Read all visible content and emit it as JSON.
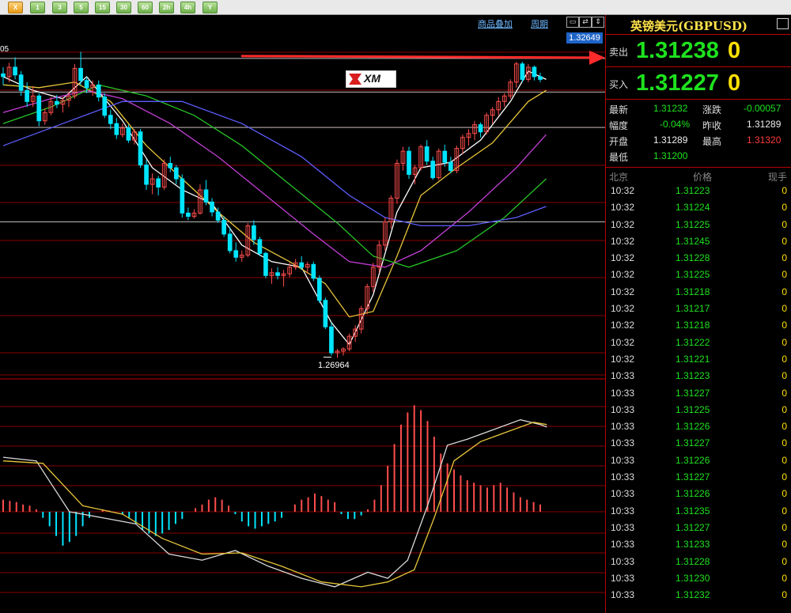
{
  "toolbar": {
    "buttons": [
      "X",
      "1",
      "3",
      "5",
      "15",
      "30",
      "60",
      "2h",
      "4h",
      "Y"
    ]
  },
  "chart_header": {
    "overlay_link": "商品叠加",
    "period_link": "周期",
    "price_tag": "1.32649",
    "low_label": "1.26964",
    "top_left_label": "05"
  },
  "colors": {
    "up": "#ff4d4d",
    "down": "#00e5ff",
    "ma1": "#ffffff",
    "ma2": "#e7c53a",
    "ma3": "#c33fd6",
    "ma4": "#27c327",
    "ma5": "#5d5dff",
    "macd_dif": "#d8d8d8",
    "macd_dea": "#e7c53a",
    "grid": "#8a0000",
    "arrow": "#ff2a2a"
  },
  "chart_data": {
    "type": "candlestick",
    "ylim": [
      1.2665,
      1.3285
    ],
    "reference_lines": [
      1.3238,
      1.3177,
      1.3113,
      1.2942
    ],
    "candles": [
      [
        1.321,
        1.3222,
        1.319,
        1.3205
      ],
      [
        1.3205,
        1.323,
        1.3195,
        1.3222
      ],
      [
        1.3222,
        1.324,
        1.32,
        1.3208
      ],
      [
        1.3208,
        1.3215,
        1.317,
        1.318
      ],
      [
        1.318,
        1.3195,
        1.315,
        1.316
      ],
      [
        1.316,
        1.3188,
        1.315,
        1.317
      ],
      [
        1.317,
        1.3175,
        1.3115,
        1.3125
      ],
      [
        1.3125,
        1.3148,
        1.3118,
        1.314
      ],
      [
        1.314,
        1.3168,
        1.3135,
        1.316
      ],
      [
        1.316,
        1.3172,
        1.3148,
        1.3155
      ],
      [
        1.3155,
        1.3168,
        1.314,
        1.3162
      ],
      [
        1.3162,
        1.3178,
        1.315,
        1.317
      ],
      [
        1.317,
        1.3228,
        1.3165,
        1.322
      ],
      [
        1.322,
        1.325,
        1.319,
        1.3198
      ],
      [
        1.3198,
        1.3205,
        1.3175,
        1.3185
      ],
      [
        1.3185,
        1.3198,
        1.317,
        1.319
      ],
      [
        1.319,
        1.3198,
        1.316,
        1.3168
      ],
      [
        1.3168,
        1.3175,
        1.313,
        1.3135
      ],
      [
        1.3135,
        1.3145,
        1.311,
        1.312
      ],
      [
        1.312,
        1.313,
        1.3092,
        1.31
      ],
      [
        1.31,
        1.312,
        1.3095,
        1.3112
      ],
      [
        1.3112,
        1.3118,
        1.3085,
        1.309
      ],
      [
        1.309,
        1.311,
        1.3082,
        1.3105
      ],
      [
        1.3105,
        1.311,
        1.304,
        1.3045
      ],
      [
        1.3045,
        1.3055,
        1.3,
        1.301
      ],
      [
        1.301,
        1.303,
        1.2992,
        1.302
      ],
      [
        1.302,
        1.3025,
        1.299,
        1.3005
      ],
      [
        1.3005,
        1.3055,
        1.3,
        1.3048
      ],
      [
        1.3048,
        1.306,
        1.3032,
        1.304
      ],
      [
        1.304,
        1.3045,
        1.301,
        1.302
      ],
      [
        1.302,
        1.3028,
        1.295,
        1.2958
      ],
      [
        1.2958,
        1.2968,
        1.2945,
        1.2952
      ],
      [
        1.2952,
        1.2965,
        1.2948,
        1.2958
      ],
      [
        1.2958,
        1.301,
        1.2955,
        1.3
      ],
      [
        1.3,
        1.3018,
        1.2972,
        1.2978
      ],
      [
        1.2978,
        1.2985,
        1.2952,
        1.296
      ],
      [
        1.296,
        1.2968,
        1.294,
        1.2945
      ],
      [
        1.2945,
        1.2952,
        1.2915,
        1.292
      ],
      [
        1.292,
        1.2932,
        1.2885,
        1.289
      ],
      [
        1.289,
        1.2905,
        1.287,
        1.2878
      ],
      [
        1.2878,
        1.289,
        1.287,
        1.2882
      ],
      [
        1.2882,
        1.294,
        1.2878,
        1.2935
      ],
      [
        1.2935,
        1.2945,
        1.29,
        1.291
      ],
      [
        1.291,
        1.2915,
        1.288,
        1.2885
      ],
      [
        1.2885,
        1.2888,
        1.284,
        1.2845
      ],
      [
        1.2845,
        1.2858,
        1.283,
        1.285
      ],
      [
        1.285,
        1.286,
        1.2838,
        1.2845
      ],
      [
        1.2845,
        1.2855,
        1.2825,
        1.2848
      ],
      [
        1.2848,
        1.2868,
        1.2842,
        1.286
      ],
      [
        1.286,
        1.2875,
        1.2855,
        1.2868
      ],
      [
        1.2868,
        1.288,
        1.2855,
        1.286
      ],
      [
        1.286,
        1.287,
        1.2848,
        1.2865
      ],
      [
        1.2865,
        1.287,
        1.2835,
        1.284
      ],
      [
        1.284,
        1.2845,
        1.2795,
        1.28
      ],
      [
        1.28,
        1.2805,
        1.2748,
        1.2752
      ],
      [
        1.2752,
        1.276,
        1.27,
        1.2705
      ],
      [
        1.2705,
        1.2712,
        1.2696,
        1.2708
      ],
      [
        1.2708,
        1.2715,
        1.27,
        1.2712
      ],
      [
        1.2712,
        1.274,
        1.2708,
        1.2735
      ],
      [
        1.2735,
        1.2755,
        1.2725,
        1.2748
      ],
      [
        1.2748,
        1.279,
        1.274,
        1.2785
      ],
      [
        1.2785,
        1.283,
        1.2775,
        1.2825
      ],
      [
        1.2825,
        1.2868,
        1.2815,
        1.286
      ],
      [
        1.286,
        1.2908,
        1.285,
        1.29
      ],
      [
        1.29,
        1.295,
        1.289,
        1.2942
      ],
      [
        1.2942,
        1.299,
        1.293,
        1.2985
      ],
      [
        1.2985,
        1.3055,
        1.2975,
        1.3048
      ],
      [
        1.3048,
        1.3078,
        1.3035,
        1.307
      ],
      [
        1.307,
        1.3078,
        1.302,
        1.3028
      ],
      [
        1.3028,
        1.3045,
        1.301,
        1.304
      ],
      [
        1.304,
        1.3082,
        1.3035,
        1.3078
      ],
      [
        1.3078,
        1.309,
        1.3045,
        1.3052
      ],
      [
        1.3052,
        1.306,
        1.3018,
        1.3022
      ],
      [
        1.3022,
        1.3075,
        1.3018,
        1.307
      ],
      [
        1.307,
        1.3082,
        1.3042,
        1.305
      ],
      [
        1.305,
        1.306,
        1.303,
        1.3035
      ],
      [
        1.3035,
        1.308,
        1.303,
        1.3075
      ],
      [
        1.3075,
        1.31,
        1.3065,
        1.3095
      ],
      [
        1.3095,
        1.311,
        1.308,
        1.3102
      ],
      [
        1.3102,
        1.3125,
        1.309,
        1.3118
      ],
      [
        1.3118,
        1.3122,
        1.3095,
        1.3105
      ],
      [
        1.3105,
        1.314,
        1.31,
        1.3135
      ],
      [
        1.3135,
        1.315,
        1.312,
        1.3145
      ],
      [
        1.3145,
        1.3168,
        1.3135,
        1.316
      ],
      [
        1.316,
        1.3175,
        1.315,
        1.317
      ],
      [
        1.317,
        1.32,
        1.3165,
        1.3195
      ],
      [
        1.3195,
        1.3232,
        1.3185,
        1.3228
      ],
      [
        1.3228,
        1.3232,
        1.3195,
        1.32
      ],
      [
        1.32,
        1.3228,
        1.3195,
        1.3222
      ],
      [
        1.3222,
        1.3225,
        1.3198,
        1.3205
      ],
      [
        1.3205,
        1.3212,
        1.3195,
        1.32
      ]
    ],
    "low_marker_index": 55,
    "moving_averages": [
      {
        "key": "ma1",
        "points": [
          [
            0,
            1.3205
          ],
          [
            5,
            1.318
          ],
          [
            10,
            1.3165
          ],
          [
            14,
            1.3205
          ],
          [
            20,
            1.3125
          ],
          [
            25,
            1.304
          ],
          [
            30,
            1.3
          ],
          [
            35,
            1.2975
          ],
          [
            40,
            1.29
          ],
          [
            45,
            1.287
          ],
          [
            50,
            1.286
          ],
          [
            55,
            1.276
          ],
          [
            58,
            1.272
          ],
          [
            62,
            1.281
          ],
          [
            66,
            1.296
          ],
          [
            70,
            1.304
          ],
          [
            75,
            1.305
          ],
          [
            80,
            1.309
          ],
          [
            85,
            1.316
          ],
          [
            88,
            1.3215
          ],
          [
            91,
            1.32
          ]
        ]
      },
      {
        "key": "ma2",
        "points": [
          [
            0,
            1.319
          ],
          [
            6,
            1.3185
          ],
          [
            12,
            1.3195
          ],
          [
            18,
            1.316
          ],
          [
            24,
            1.308
          ],
          [
            30,
            1.302
          ],
          [
            36,
            1.296
          ],
          [
            42,
            1.2905
          ],
          [
            48,
            1.287
          ],
          [
            54,
            1.283
          ],
          [
            58,
            1.277
          ],
          [
            62,
            1.278
          ],
          [
            66,
            1.288
          ],
          [
            70,
            1.299
          ],
          [
            76,
            1.304
          ],
          [
            82,
            1.3085
          ],
          [
            88,
            1.316
          ],
          [
            91,
            1.318
          ]
        ]
      },
      {
        "key": "ma3",
        "points": [
          [
            0,
            1.314
          ],
          [
            8,
            1.3165
          ],
          [
            14,
            1.318
          ],
          [
            20,
            1.3165
          ],
          [
            28,
            1.312
          ],
          [
            36,
            1.306
          ],
          [
            44,
            1.299
          ],
          [
            52,
            1.292
          ],
          [
            58,
            1.287
          ],
          [
            64,
            1.286
          ],
          [
            70,
            1.289
          ],
          [
            78,
            1.296
          ],
          [
            86,
            1.304
          ],
          [
            91,
            1.31
          ]
        ]
      },
      {
        "key": "ma4",
        "points": [
          [
            0,
            1.312
          ],
          [
            8,
            1.315
          ],
          [
            16,
            1.319
          ],
          [
            24,
            1.317
          ],
          [
            32,
            1.3135
          ],
          [
            40,
            1.308
          ],
          [
            48,
            1.301
          ],
          [
            56,
            1.294
          ],
          [
            62,
            1.288
          ],
          [
            68,
            1.286
          ],
          [
            76,
            1.289
          ],
          [
            84,
            1.295
          ],
          [
            91,
            1.302
          ]
        ]
      },
      {
        "key": "ma5",
        "points": [
          [
            0,
            1.308
          ],
          [
            10,
            1.312
          ],
          [
            20,
            1.316
          ],
          [
            30,
            1.316
          ],
          [
            40,
            1.312
          ],
          [
            50,
            1.306
          ],
          [
            58,
            1.299
          ],
          [
            64,
            1.295
          ],
          [
            70,
            1.2935
          ],
          [
            78,
            1.2935
          ],
          [
            86,
            1.295
          ],
          [
            91,
            1.297
          ]
        ]
      }
    ],
    "macd": {
      "ylim": [
        -1.0,
        1.0
      ],
      "histogram": [
        0.1,
        0.09,
        0.08,
        0.06,
        0.05,
        0.02,
        -0.05,
        -0.12,
        -0.2,
        -0.28,
        -0.25,
        -0.2,
        -0.12,
        -0.05,
        0.0,
        0.02,
        0.01,
        0.0,
        -0.02,
        -0.05,
        -0.1,
        -0.15,
        -0.18,
        -0.2,
        -0.18,
        -0.15,
        -0.1,
        -0.06,
        0.0,
        0.03,
        0.06,
        0.1,
        0.12,
        0.1,
        0.05,
        -0.02,
        -0.08,
        -0.12,
        -0.14,
        -0.12,
        -0.1,
        -0.08,
        -0.05,
        0.0,
        0.06,
        0.1,
        0.12,
        0.15,
        0.13,
        0.1,
        0.08,
        -0.02,
        -0.06,
        -0.06,
        -0.03,
        0.02,
        0.1,
        0.22,
        0.38,
        0.56,
        0.72,
        0.82,
        0.88,
        0.84,
        0.75,
        0.62,
        0.48,
        0.4,
        0.35,
        0.3,
        0.26,
        0.24,
        0.22,
        0.2,
        0.22,
        0.24,
        0.2,
        0.16,
        0.12,
        0.1,
        0.08,
        0.06
      ],
      "dif": [
        [
          0,
          0.45
        ],
        [
          5,
          0.42
        ],
        [
          10,
          0.0
        ],
        [
          15,
          -0.05
        ],
        [
          20,
          -0.1
        ],
        [
          25,
          -0.35
        ],
        [
          30,
          -0.4
        ],
        [
          35,
          -0.32
        ],
        [
          40,
          -0.45
        ],
        [
          45,
          -0.55
        ],
        [
          50,
          -0.62
        ],
        [
          55,
          -0.5
        ],
        [
          58,
          -0.55
        ],
        [
          61,
          -0.4
        ],
        [
          64,
          0.05
        ],
        [
          67,
          0.55
        ],
        [
          70,
          0.6
        ],
        [
          74,
          0.68
        ],
        [
          78,
          0.76
        ],
        [
          81,
          0.72
        ],
        [
          82,
          0.7
        ]
      ],
      "dea": [
        [
          0,
          0.42
        ],
        [
          6,
          0.4
        ],
        [
          12,
          0.05
        ],
        [
          18,
          -0.02
        ],
        [
          24,
          -0.22
        ],
        [
          30,
          -0.35
        ],
        [
          36,
          -0.34
        ],
        [
          42,
          -0.45
        ],
        [
          48,
          -0.58
        ],
        [
          54,
          -0.62
        ],
        [
          58,
          -0.58
        ],
        [
          62,
          -0.48
        ],
        [
          65,
          -0.05
        ],
        [
          68,
          0.42
        ],
        [
          72,
          0.58
        ],
        [
          76,
          0.66
        ],
        [
          80,
          0.74
        ],
        [
          82,
          0.72
        ]
      ]
    }
  },
  "quote": {
    "symbol": "英镑美元(GBPUSD)",
    "sell_label": "卖出",
    "sell_price": "1.31238",
    "sell_size": "0",
    "buy_label": "买入",
    "buy_price": "1.31227",
    "buy_size": "0"
  },
  "stats": {
    "last_label": "最新",
    "last": "1.31232",
    "change_label": "涨跌",
    "change": "-0.00057",
    "pct_label": "幅度",
    "pct": "-0.04%",
    "prev_label": "昨收",
    "prev": "1.31289",
    "open_label": "开盘",
    "open": "1.31289",
    "high_label": "最高",
    "high": "1.31320",
    "low_label": "最低",
    "low": "1.31200"
  },
  "ticks_header": {
    "time": "北京",
    "price": "价格",
    "vol": "现手"
  },
  "ticks": [
    {
      "time": "10:32",
      "price": "1.31223",
      "vol": "0"
    },
    {
      "time": "10:32",
      "price": "1.31224",
      "vol": "0"
    },
    {
      "time": "10:32",
      "price": "1.31225",
      "vol": "0"
    },
    {
      "time": "10:32",
      "price": "1.31245",
      "vol": "0"
    },
    {
      "time": "10:32",
      "price": "1.31228",
      "vol": "0"
    },
    {
      "time": "10:32",
      "price": "1.31225",
      "vol": "0"
    },
    {
      "time": "10:32",
      "price": "1.31218",
      "vol": "0"
    },
    {
      "time": "10:32",
      "price": "1.31217",
      "vol": "0"
    },
    {
      "time": "10:32",
      "price": "1.31218",
      "vol": "0"
    },
    {
      "time": "10:32",
      "price": "1.31222",
      "vol": "0"
    },
    {
      "time": "10:32",
      "price": "1.31221",
      "vol": "0"
    },
    {
      "time": "10:33",
      "price": "1.31223",
      "vol": "0"
    },
    {
      "time": "10:33",
      "price": "1.31227",
      "vol": "0"
    },
    {
      "time": "10:33",
      "price": "1.31225",
      "vol": "0"
    },
    {
      "time": "10:33",
      "price": "1.31226",
      "vol": "0"
    },
    {
      "time": "10:33",
      "price": "1.31227",
      "vol": "0"
    },
    {
      "time": "10:33",
      "price": "1.31226",
      "vol": "0"
    },
    {
      "time": "10:33",
      "price": "1.31227",
      "vol": "0"
    },
    {
      "time": "10:33",
      "price": "1.31226",
      "vol": "0"
    },
    {
      "time": "10:33",
      "price": "1.31235",
      "vol": "0"
    },
    {
      "time": "10:33",
      "price": "1.31227",
      "vol": "0"
    },
    {
      "time": "10:33",
      "price": "1.31233",
      "vol": "0"
    },
    {
      "time": "10:33",
      "price": "1.31228",
      "vol": "0"
    },
    {
      "time": "10:33",
      "price": "1.31230",
      "vol": "0"
    },
    {
      "time": "10:33",
      "price": "1.31232",
      "vol": "0"
    }
  ]
}
